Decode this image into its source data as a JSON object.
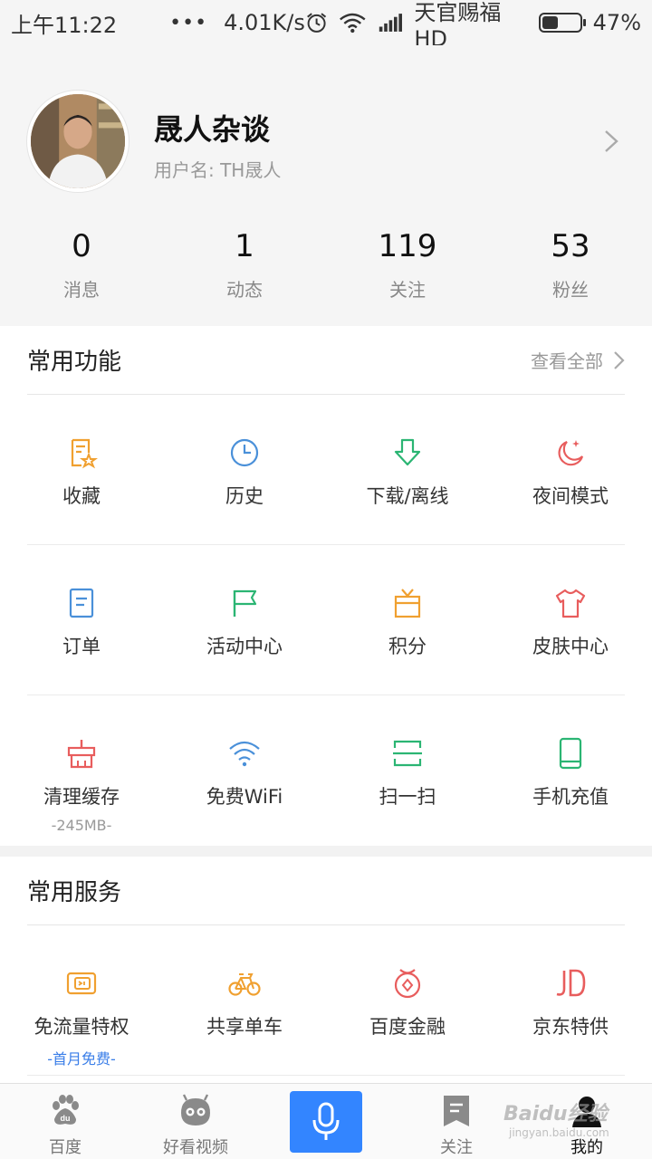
{
  "status_bar": {
    "time": "上午11:22",
    "more": "•••",
    "speed": "4.01K/s",
    "carrier": "天官赐福 HD",
    "battery_text": "47%",
    "battery_level": 0.47
  },
  "profile": {
    "name": "晟人杂谈",
    "username": "用户名: TH晟人",
    "stats": [
      {
        "value": "0",
        "label": "消息"
      },
      {
        "value": "1",
        "label": "动态"
      },
      {
        "value": "119",
        "label": "关注"
      },
      {
        "value": "53",
        "label": "粉丝"
      }
    ]
  },
  "common_functions": {
    "title": "常用功能",
    "view_all": "查看全部",
    "items": [
      {
        "label": "收藏",
        "icon": "favorite-icon",
        "color": "#f0a030"
      },
      {
        "label": "历史",
        "icon": "history-clock-icon",
        "color": "#4a90d9"
      },
      {
        "label": "下载/离线",
        "icon": "download-icon",
        "color": "#2bb573"
      },
      {
        "label": "夜间模式",
        "icon": "night-moon-icon",
        "color": "#e85d5d"
      },
      {
        "label": "订单",
        "icon": "order-icon",
        "color": "#4a90d9"
      },
      {
        "label": "活动中心",
        "icon": "flag-icon",
        "color": "#2bb573"
      },
      {
        "label": "积分",
        "icon": "points-gift-icon",
        "color": "#f0a030"
      },
      {
        "label": "皮肤中心",
        "icon": "skin-shirt-icon",
        "color": "#e85d5d"
      },
      {
        "label": "清理缓存",
        "sub": "-245MB-",
        "icon": "clean-cache-icon",
        "color": "#e85d5d"
      },
      {
        "label": "免费WiFi",
        "icon": "wifi-icon",
        "color": "#4a90d9"
      },
      {
        "label": "扫一扫",
        "icon": "scan-icon",
        "color": "#2bb573"
      },
      {
        "label": "手机充值",
        "icon": "phone-topup-icon",
        "color": "#2bb573"
      }
    ]
  },
  "common_services": {
    "title": "常用服务",
    "items": [
      {
        "label": "免流量特权",
        "sub": "-首月免费-",
        "icon": "data-card-icon",
        "color": "#f0a030"
      },
      {
        "label": "共享单车",
        "icon": "bicycle-icon",
        "color": "#f0a030"
      },
      {
        "label": "百度金融",
        "icon": "finance-icon",
        "color": "#e85d5d"
      },
      {
        "label": "京东特供",
        "icon": "jd-logo-icon",
        "glyph": "JD",
        "color": "#e85d5d"
      }
    ]
  },
  "bottom_nav": {
    "items": [
      {
        "label": "百度",
        "icon": "baidu-paw-icon"
      },
      {
        "label": "好看视频",
        "icon": "video-face-icon"
      },
      {
        "label": "",
        "icon": "microphone-icon"
      },
      {
        "label": "关注",
        "icon": "bookmark-icon"
      },
      {
        "label": "我的",
        "icon": "profile-icon"
      }
    ]
  },
  "watermark": {
    "text": "Baidu经验",
    "sub": "jingyan.baidu.com"
  }
}
